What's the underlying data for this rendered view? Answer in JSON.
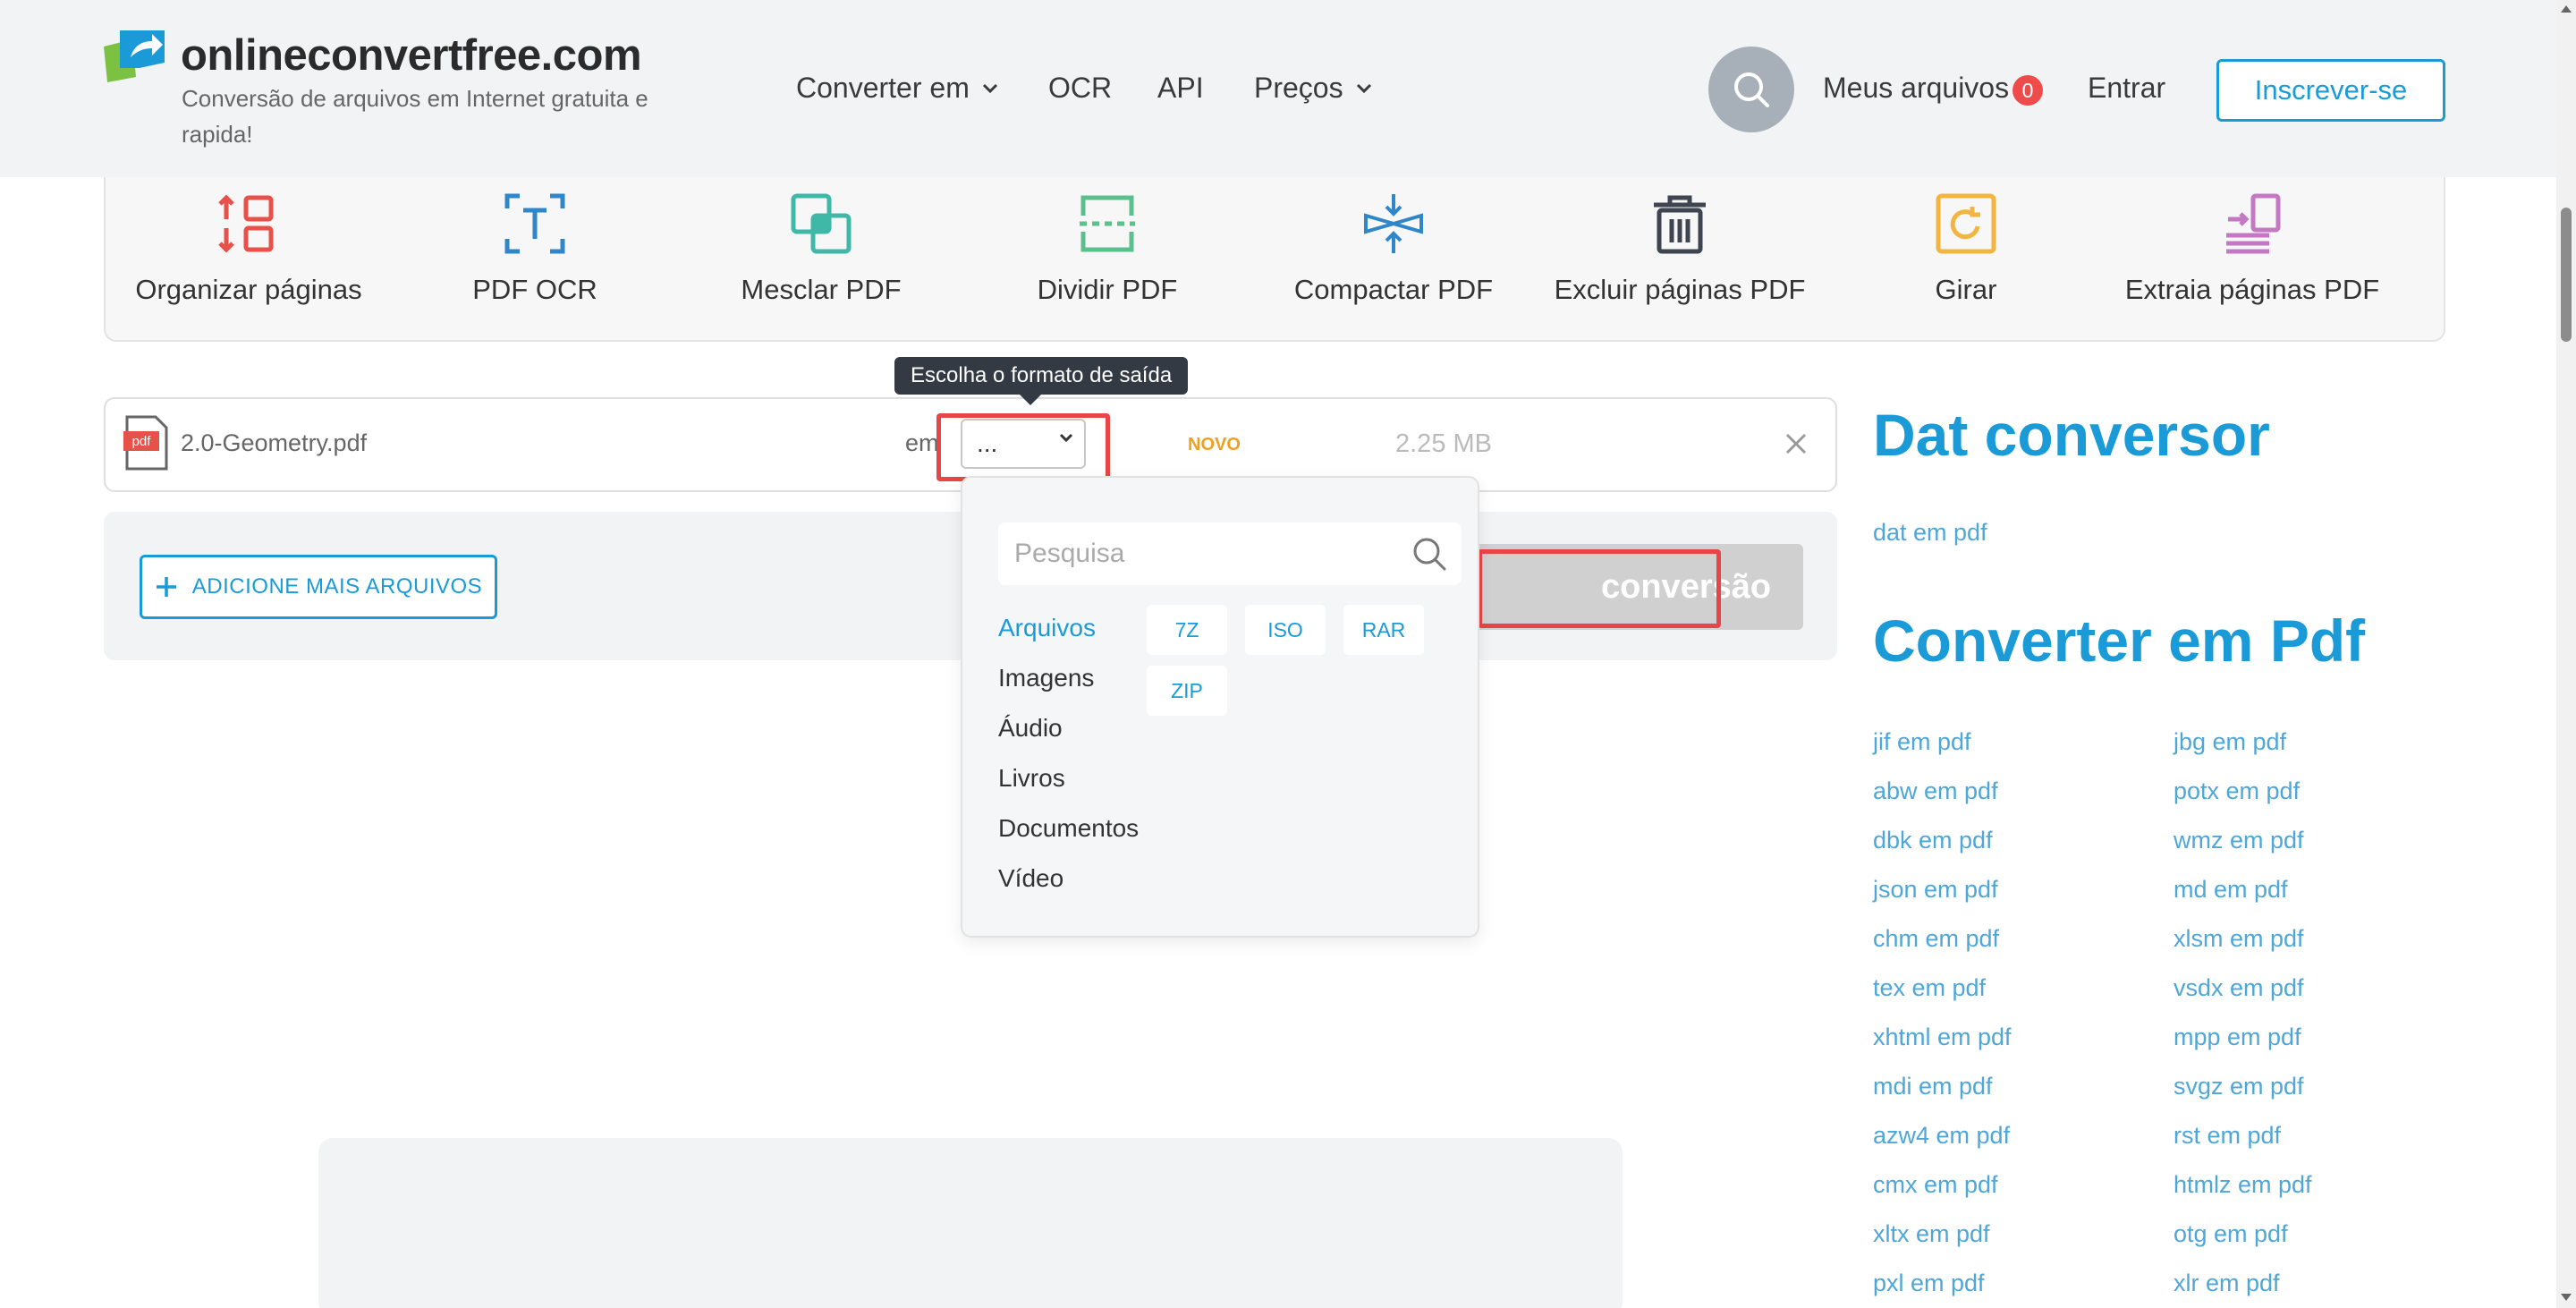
{
  "header": {
    "logo_name": "onlineconvertfree.com",
    "logo_tagline": "Conversão de arquivos em Internet gratuita e rapida!",
    "nav": {
      "convert": "Converter em",
      "ocr": "OCR",
      "api": "API",
      "pricing": "Preços"
    },
    "my_files": "Meus arquivos",
    "my_files_count": "0",
    "login": "Entrar",
    "signup": "Inscrever-se"
  },
  "tools": [
    {
      "label": "Organizar páginas",
      "icon": "organize-pages-icon",
      "color": "#e8504a"
    },
    {
      "label": "PDF OCR",
      "icon": "ocr-icon",
      "color": "#2f86c9"
    },
    {
      "label": "Mesclar PDF",
      "icon": "merge-icon",
      "color": "#3fb8a8"
    },
    {
      "label": "Dividir PDF",
      "icon": "split-icon",
      "color": "#5bbf8e"
    },
    {
      "label": "Compactar PDF",
      "icon": "compress-icon",
      "color": "#2f86c9"
    },
    {
      "label": "Excluir páginas PDF",
      "icon": "trash-icon",
      "color": "#3e4450"
    },
    {
      "label": "Girar",
      "icon": "rotate-icon",
      "color": "#f2b640"
    },
    {
      "label": "Extraia páginas PDF",
      "icon": "extract-pages-icon",
      "color": "#c478c4"
    }
  ],
  "file": {
    "name": "2.0-Geometry.pdf",
    "icon_text": "pdf",
    "em_label": "em",
    "format_value": "...",
    "badge": "NOVO",
    "size": "2.25 MB"
  },
  "tooltip": "Escolha o formato de saída",
  "actions": {
    "add_files": "ADICIONE MAIS ARQUIVOS",
    "convert": "conversão"
  },
  "dropdown": {
    "search_placeholder": "Pesquisa",
    "categories": [
      "Arquivos",
      "Imagens",
      "Áudio",
      "Livros",
      "Documentos",
      "Vídeo"
    ],
    "active_category": "Arquivos",
    "formats": [
      "7Z",
      "ISO",
      "RAR",
      "ZIP"
    ]
  },
  "sidebar": {
    "heading1": "Dat conversor",
    "link1": "dat em pdf",
    "heading2": "Converter em Pdf",
    "links_col1": [
      "jif em pdf",
      "abw em pdf",
      "dbk em pdf",
      "json em pdf",
      "chm em pdf",
      "tex em pdf",
      "xhtml em pdf",
      "mdi em pdf",
      "azw4 em pdf",
      "cmx em pdf",
      "xltx em pdf",
      "pxl em pdf"
    ],
    "links_col2": [
      "jbg em pdf",
      "potx em pdf",
      "wmz em pdf",
      "md em pdf",
      "xlsm em pdf",
      "vsdx em pdf",
      "mpp em pdf",
      "svgz em pdf",
      "rst em pdf",
      "htmlz em pdf",
      "otg em pdf",
      "xlr em pdf"
    ]
  },
  "colors": {
    "accent": "#1a9bd7",
    "highlight": "#e84646",
    "badge": "#ef4b4b",
    "novo": "#f0a020"
  }
}
